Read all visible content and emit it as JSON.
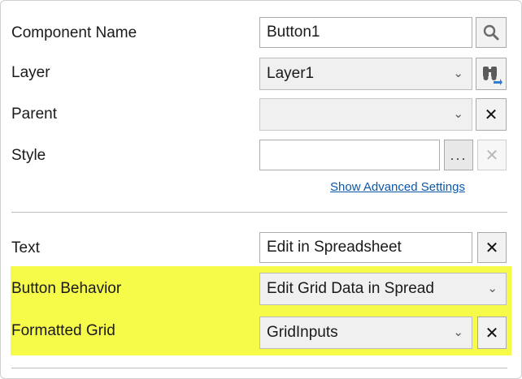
{
  "fields": {
    "component_name": {
      "label": "Component Name",
      "value": "Button1"
    },
    "layer": {
      "label": "Layer",
      "value": "Layer1"
    },
    "parent": {
      "label": "Parent",
      "value": ""
    },
    "style": {
      "label": "Style",
      "value": ""
    },
    "text": {
      "label": "Text",
      "value": "Edit in Spreadsheet"
    },
    "button_behavior": {
      "label": "Button Behavior",
      "value": "Edit Grid Data in Spread"
    },
    "formatted_grid": {
      "label": "Formatted Grid",
      "value": "GridInputs"
    }
  },
  "advanced_link": "Show Advanced Settings",
  "buttons": {
    "ellipsis": "...",
    "clear": "✕"
  },
  "colors": {
    "highlight": "#f6fb4a",
    "link": "#0b57a8"
  }
}
